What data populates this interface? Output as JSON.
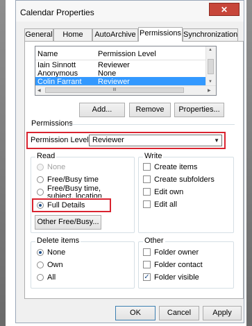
{
  "window": {
    "title": "Calendar Properties",
    "close_glyph": "✕"
  },
  "tabs": [
    {
      "label": "General"
    },
    {
      "label": "Home Page"
    },
    {
      "label": "AutoArchive"
    },
    {
      "label": "Permissions"
    },
    {
      "label": "Synchronization"
    }
  ],
  "permissions_list": {
    "headers": [
      "Name",
      "Permission Level"
    ],
    "rows": [
      {
        "name": "Iain Sinnott",
        "level": "Reviewer"
      },
      {
        "name": "Anonymous",
        "level": "None"
      },
      {
        "name": "Colin Farrant",
        "level": "Reviewer"
      }
    ],
    "hscroll_glyph": "III"
  },
  "buttons": {
    "add": "Add...",
    "remove": "Remove",
    "properties": "Properties..."
  },
  "permissions_section": {
    "title": "Permissions",
    "level_label": "Permission Level:",
    "level_value": "Reviewer"
  },
  "read_group": {
    "title": "Read",
    "options": [
      "None",
      "Free/Busy time",
      "Free/Busy time, subject, location",
      "Full Details"
    ],
    "selected": "Full Details",
    "other_button": "Other Free/Busy..."
  },
  "write_group": {
    "title": "Write",
    "options": [
      {
        "label": "Create items",
        "checked": false
      },
      {
        "label": "Create subfolders",
        "checked": false
      },
      {
        "label": "Edit own",
        "checked": false
      },
      {
        "label": "Edit all",
        "checked": false
      }
    ]
  },
  "delete_group": {
    "title": "Delete items",
    "options": [
      "None",
      "Own",
      "All"
    ],
    "selected": "None"
  },
  "other_group": {
    "title": "Other",
    "options": [
      {
        "label": "Folder owner",
        "checked": false
      },
      {
        "label": "Folder contact",
        "checked": false
      },
      {
        "label": "Folder visible",
        "checked": true
      }
    ]
  },
  "footer": {
    "ok": "OK",
    "cancel": "Cancel",
    "apply": "Apply"
  },
  "colors": {
    "selection": "#3399ff",
    "highlight_box": "#d9232f",
    "close_button": "#c7463a"
  }
}
